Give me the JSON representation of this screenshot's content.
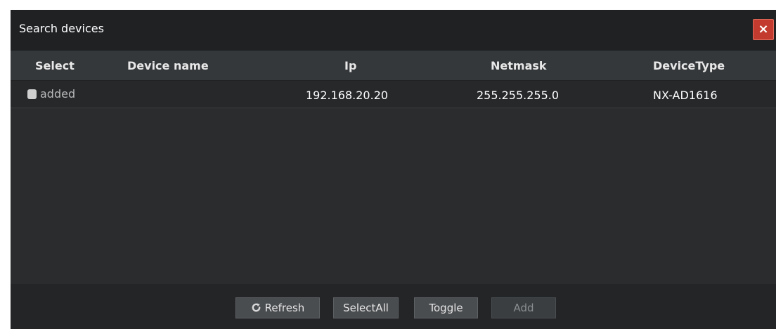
{
  "dialog": {
    "title": "Search devices",
    "close_label": "×"
  },
  "table": {
    "headers": [
      "Select",
      "Device name",
      "Ip",
      "Netmask",
      "DeviceType"
    ],
    "rows": [
      {
        "select_label": "added",
        "device_name": "",
        "ip": "192.168.20.20",
        "netmask": "255.255.255.0",
        "device_type": "NX-AD1616"
      }
    ]
  },
  "buttons": {
    "refresh": "Refresh",
    "select_all": "SelectAll",
    "toggle": "Toggle",
    "add": "Add"
  },
  "icons": {
    "refresh": "refresh-icon",
    "close": "close-icon"
  },
  "colors": {
    "background": "#2a2c2e",
    "close": "#c33b2e"
  }
}
